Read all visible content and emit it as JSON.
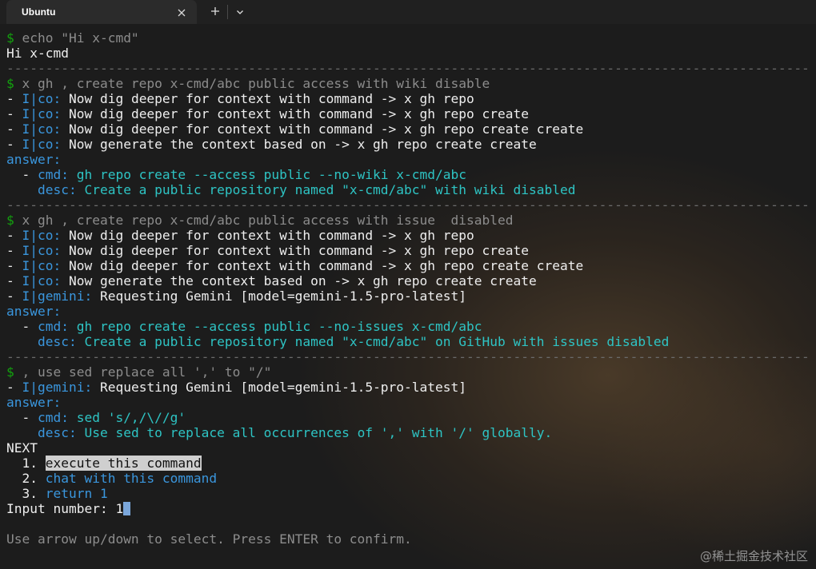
{
  "tab": {
    "title": "Ubuntu"
  },
  "icons": {
    "close": "close-icon",
    "new_tab": "plus-icon",
    "dropdown": "chevron-down-icon"
  },
  "terminal": {
    "block1": {
      "prompt": "$",
      "command": " echo \"Hi x-cmd\"",
      "output": "Hi x-cmd"
    },
    "separator": "-------------------------------------------------------------------------------------------------------",
    "block2": {
      "prompt": "$",
      "command": " x gh , create repo x-cmd/abc public access with wiki disable",
      "logs": [
        {
          "dash": "- ",
          "tag": "I|co:",
          "text": " Now dig deeper for context with command -> x gh repo"
        },
        {
          "dash": "- ",
          "tag": "I|co:",
          "text": " Now dig deeper for context with command -> x gh repo create"
        },
        {
          "dash": "- ",
          "tag": "I|co:",
          "text": " Now dig deeper for context with command -> x gh repo create create"
        },
        {
          "dash": "- ",
          "tag": "I|co:",
          "text": " Now generate the context based on -> x gh repo create create"
        }
      ],
      "answer_label": "answer:",
      "cmd_dash": "  - ",
      "cmd_key": "cmd:",
      "cmd_value": " gh repo create --access public --no-wiki x-cmd/abc",
      "desc_indent": "    ",
      "desc_key": "desc:",
      "desc_value": " Create a public repository named \"x-cmd/abc\" with wiki disabled"
    },
    "block3": {
      "prompt": "$",
      "command": " x gh , create repo x-cmd/abc public access with issue  disabled",
      "logs": [
        {
          "dash": "- ",
          "tag": "I|co:",
          "text": " Now dig deeper for context with command -> x gh repo"
        },
        {
          "dash": "- ",
          "tag": "I|co:",
          "text": " Now dig deeper for context with command -> x gh repo create"
        },
        {
          "dash": "- ",
          "tag": "I|co:",
          "text": " Now dig deeper for context with command -> x gh repo create create"
        },
        {
          "dash": "- ",
          "tag": "I|co:",
          "text": " Now generate the context based on -> x gh repo create create"
        },
        {
          "dash": "- ",
          "tag": "I|gemini:",
          "text": " Requesting Gemini [model=gemini-1.5-pro-latest]"
        }
      ],
      "answer_label": "answer:",
      "cmd_dash": "  - ",
      "cmd_key": "cmd:",
      "cmd_value": " gh repo create --access public --no-issues x-cmd/abc",
      "desc_indent": "    ",
      "desc_key": "desc:",
      "desc_value": " Create a public repository named \"x-cmd/abc\" on GitHub with issues disabled"
    },
    "block4": {
      "prompt": "$",
      "command": " , use sed replace all ',' to \"/\"",
      "logs": [
        {
          "dash": "- ",
          "tag": "I|gemini:",
          "text": " Requesting Gemini [model=gemini-1.5-pro-latest]"
        }
      ],
      "answer_label": "answer:",
      "cmd_dash": "  - ",
      "cmd_key": "cmd:",
      "cmd_value": " sed 's/,/\\//g'",
      "desc_indent": "    ",
      "desc_key": "desc:",
      "desc_value": " Use sed to replace all occurrences of ',' with '/' globally."
    },
    "next_label": "NEXT",
    "menu": [
      {
        "num": "  1. ",
        "label": "execute this command",
        "selected": true
      },
      {
        "num": "  2. ",
        "label": "chat with this command",
        "selected": false
      },
      {
        "num": "  3. ",
        "label": "return 1",
        "selected": false
      }
    ],
    "input_label": "Input number: ",
    "input_value": "1",
    "hint": "Use arrow up/down to select. Press ENTER to confirm."
  },
  "watermark": "@稀土掘金技术社区",
  "colors": {
    "prompt": "#13a10e",
    "dim": "#8c8c8c",
    "tag_blue": "#3a96dd",
    "cyan": "#2ec4c4",
    "cursor": "#7aa6da"
  }
}
